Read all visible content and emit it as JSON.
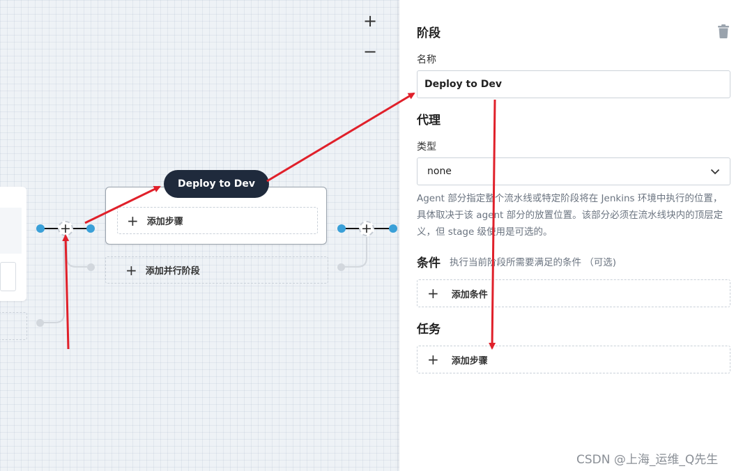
{
  "canvas": {
    "zoom_in": "+",
    "zoom_out": "−",
    "stage": {
      "name": "Deploy to Dev",
      "add_step_label": "添加步骤"
    },
    "add_parallel_label": "添加并行阶段",
    "add_node_glyph": "+"
  },
  "panel": {
    "stage_heading": "阶段",
    "name_label": "名称",
    "name_value": "Deploy to Dev",
    "agent_heading": "代理",
    "type_label": "类型",
    "type_value": "none",
    "agent_description": "Agent 部分指定整个流水线或特定阶段将在 Jenkins 环境中执行的位置， 具体取决于该 agent 部分的放置位置。该部分必须在流水线块内的顶层定义，但 stage 级使用是可选的。",
    "conditions_heading": "条件",
    "conditions_hint": "执行当前阶段所需要满足的条件 （可选)",
    "add_condition_label": "添加条件",
    "tasks_heading": "任务",
    "add_step_label": "添加步骤"
  },
  "watermark": "CSDN @上海_运维_Q先生",
  "colors": {
    "accent_blue": "#3aa0d8",
    "stage_pill": "#1f2a3c",
    "annotation_red": "#e0202a"
  }
}
